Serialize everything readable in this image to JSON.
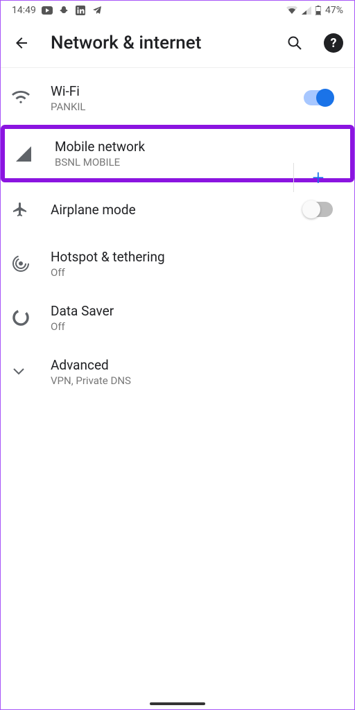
{
  "statusbar": {
    "time": "14:49",
    "battery": "47%"
  },
  "header": {
    "title": "Network & internet"
  },
  "items": {
    "wifi": {
      "title": "Wi-Fi",
      "sub": "PANKIL"
    },
    "mobile": {
      "title": "Mobile network",
      "sub": "BSNL MOBILE"
    },
    "airplane": {
      "title": "Airplane mode"
    },
    "hotspot": {
      "title": "Hotspot & tethering",
      "sub": "Off"
    },
    "datasaver": {
      "title": "Data Saver",
      "sub": "Off"
    },
    "advanced": {
      "title": "Advanced",
      "sub": "VPN, Private DNS"
    }
  },
  "actions": {
    "plus": "+"
  }
}
